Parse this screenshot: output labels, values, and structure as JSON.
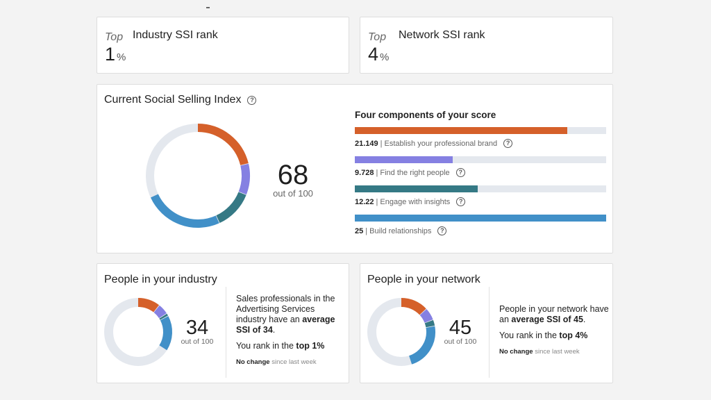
{
  "colors": {
    "brand": "#d5602a",
    "people": "#8580e2",
    "insights": "#357985",
    "relationships": "#4190c8",
    "track": "#e4e8ee"
  },
  "industry_rank": {
    "prefix": "Top",
    "title": "Industry SSI rank",
    "value": "1",
    "unit": "%"
  },
  "network_rank": {
    "prefix": "Top",
    "title": "Network SSI rank",
    "value": "4",
    "unit": "%"
  },
  "ssi": {
    "title": "Current Social Selling Index",
    "help_icon": "question-circle-icon",
    "score": "68",
    "score_sub": "out of 100",
    "components_title": "Four components of your score",
    "component_max": 25,
    "components": [
      {
        "value": "21.149",
        "sep": "|",
        "label": "Establish your professional brand",
        "amount": 21.149,
        "color_key": "brand"
      },
      {
        "value": "9.728",
        "sep": "|",
        "label": "Find the right people",
        "amount": 9.728,
        "color_key": "people"
      },
      {
        "value": "12.22",
        "sep": "|",
        "label": "Engage with insights",
        "amount": 12.22,
        "color_key": "insights"
      },
      {
        "value": "25",
        "sep": "|",
        "label": "Build relationships",
        "amount": 25,
        "color_key": "relationships"
      }
    ]
  },
  "industry": {
    "title": "People in your industry",
    "score": "34",
    "score_sub": "out of 100",
    "segments": [
      10.5,
      5.2,
      1.3,
      17
    ],
    "text_1_pre": "Sales professionals in the Advertising Services industry have an ",
    "text_1_bold": "average SSI of 34",
    "text_1_post": ".",
    "text_2_pre": "You rank in the ",
    "text_2_bold": "top 1%",
    "note_bold": "No change",
    "note_rest": " since last week"
  },
  "network": {
    "title": "People in your network",
    "score": "45",
    "score_sub": "out of 100",
    "segments": [
      13,
      6,
      3,
      23
    ],
    "text_1_pre": "People in your network have an ",
    "text_1_bold": "average SSI of 45",
    "text_1_post": ".",
    "text_2_pre": "You rank in the ",
    "text_2_bold": "top 4%",
    "note_bold": "No change",
    "note_rest": " since last week"
  }
}
